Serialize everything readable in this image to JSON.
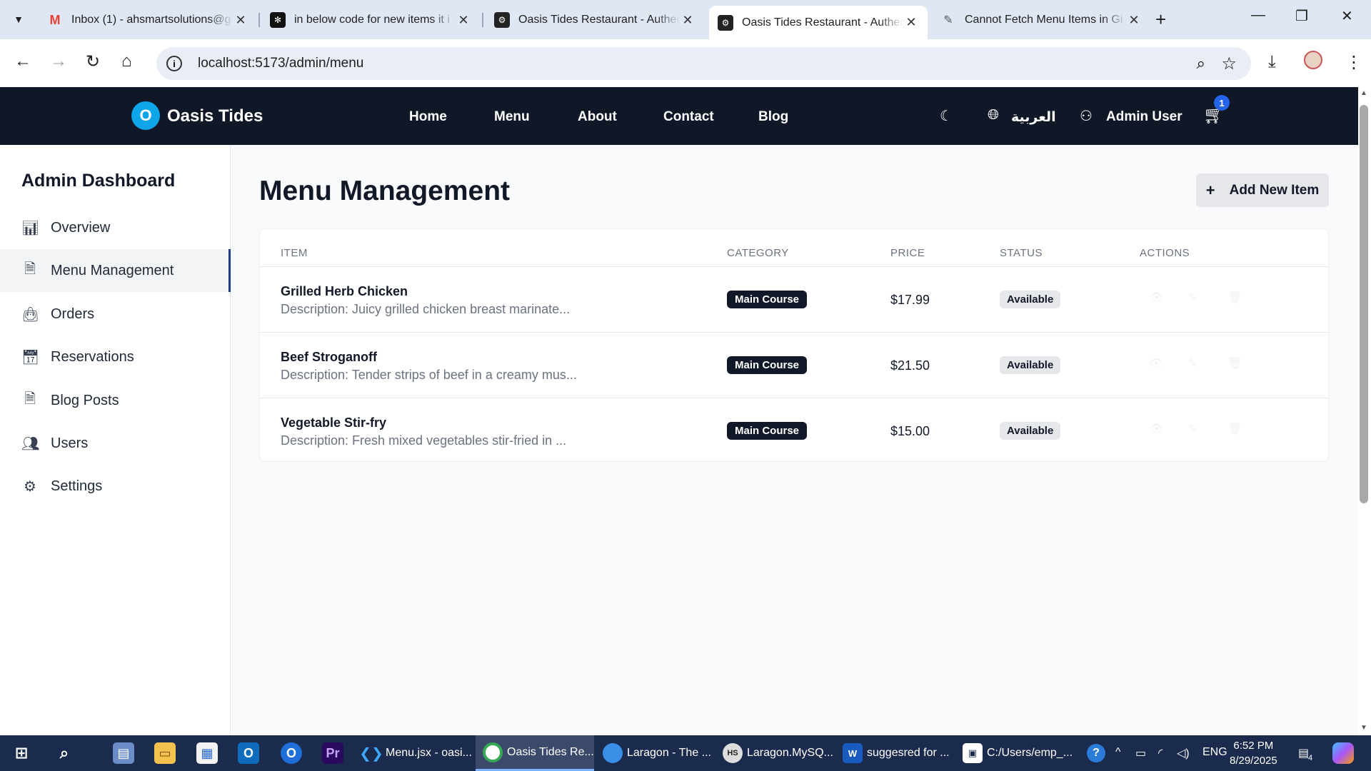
{
  "browser": {
    "tabs": [
      {
        "title": "Inbox (1) - ahsmartsolutions@g",
        "favicon": "gmail-icon",
        "active": false
      },
      {
        "title": "in below code for new items it i",
        "favicon": "chatgpt-icon",
        "active": false
      },
      {
        "title": "Oasis Tides Restaurant - Authen",
        "favicon": "app-icon",
        "active": false
      },
      {
        "title": "Oasis Tides Restaurant - Authen",
        "favicon": "app-icon",
        "active": true
      },
      {
        "title": "Cannot Fetch Menu Items in Gi",
        "favicon": "claude-icon",
        "active": false
      }
    ],
    "url": "localhost:5173/admin/menu"
  },
  "site": {
    "logo_letter": "O",
    "brand": "Oasis Tides",
    "nav": [
      "Home",
      "Menu",
      "About",
      "Contact",
      "Blog"
    ],
    "language": "العربية",
    "user": "Admin User",
    "cart_count": "1"
  },
  "sidebar": {
    "title": "Admin Dashboard",
    "items": [
      {
        "label": "Overview",
        "icon": "chart-icon"
      },
      {
        "label": "Menu Management",
        "icon": "document-icon",
        "active": true
      },
      {
        "label": "Orders",
        "icon": "shopping-bag-icon"
      },
      {
        "label": "Reservations",
        "icon": "calendar-icon"
      },
      {
        "label": "Blog Posts",
        "icon": "document-icon"
      },
      {
        "label": "Users",
        "icon": "users-icon"
      },
      {
        "label": "Settings",
        "icon": "gear-icon"
      }
    ]
  },
  "main": {
    "title": "Menu Management",
    "add_button": "Add New Item",
    "columns": [
      "ITEM",
      "CATEGORY",
      "PRICE",
      "STATUS",
      "ACTIONS"
    ],
    "rows": [
      {
        "name": "Grilled Herb Chicken",
        "description": "Description: Juicy grilled chicken breast marinate...",
        "category": "Main Course",
        "price": "$17.99",
        "status": "Available"
      },
      {
        "name": "Beef Stroganoff",
        "description": "Description: Tender strips of beef in a creamy mus...",
        "category": "Main Course",
        "price": "$21.50",
        "status": "Available"
      },
      {
        "name": "Vegetable Stir-fry",
        "description": "Description: Fresh mixed vegetables stir-fried in ...",
        "category": "Main Course",
        "price": "$15.00",
        "status": "Available"
      }
    ]
  },
  "taskbar": {
    "apps": [
      {
        "label": "Menu.jsx - oasi...",
        "icon": "vscode-icon"
      },
      {
        "label": "Oasis Tides Re...",
        "icon": "chrome-icon",
        "active": true
      },
      {
        "label": "Laragon - The ...",
        "icon": "laragon-icon"
      },
      {
        "label": "Laragon.MySQ...",
        "icon": "heidisql-icon"
      },
      {
        "label": "suggesred for ...",
        "icon": "word-icon"
      },
      {
        "label": "C:/Users/emp_...",
        "icon": "terminal-icon"
      }
    ],
    "language": "ENG",
    "time": "6:52 PM",
    "date": "8/29/2025",
    "notifications": "4"
  },
  "colors": {
    "nav_bg": "#101828",
    "logo_accent": "#0ea5e9",
    "badge_dark": "#111827",
    "cart_badge": "#2563eb",
    "taskbar_bg": "#1b2b4d"
  }
}
